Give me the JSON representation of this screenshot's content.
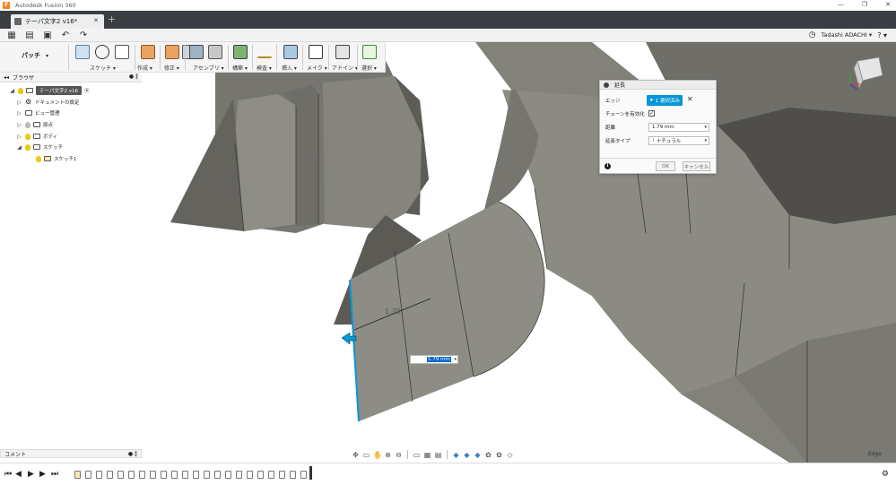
{
  "titlebar": {
    "title": "Autodesk Fusion 360",
    "controls": [
      "—",
      "❐",
      "✕"
    ]
  },
  "tab": {
    "label": "テーパ文字2 v16*",
    "close": "✕",
    "new_tab": "+"
  },
  "qab": {
    "user_name": "Tadashi ADACHI ▾",
    "help": "? ▾"
  },
  "toolbar": {
    "workspace": "パッチ",
    "groups": [
      {
        "label": "スケッチ ▾"
      },
      {
        "label": "作成 ▾"
      },
      {
        "label": "修正 ▾"
      },
      {
        "label": "アセンブリ ▾"
      },
      {
        "label": "構築 ▾"
      },
      {
        "label": "検査 ▾"
      },
      {
        "label": "挿入 ▾"
      },
      {
        "label": "メイク ▾"
      },
      {
        "label": "アドイン ▾"
      },
      {
        "label": "選択 ▾"
      }
    ]
  },
  "browser": {
    "title": "ブラウザ",
    "items": [
      {
        "label": "テーパ文字2 v16"
      },
      {
        "label": "ドキュメントの設定"
      },
      {
        "label": "ビュー管理"
      },
      {
        "label": "原点"
      },
      {
        "label": "ボディ"
      },
      {
        "label": "スケッチ"
      },
      {
        "label": "スケッチ1"
      }
    ]
  },
  "comments": {
    "title": "コメント"
  },
  "dialog": {
    "title": "延長",
    "edge_label": "エッジ",
    "edge_selection": "1 選択済み",
    "chain_label": "チェーンを有効化",
    "chain_checked": "✓",
    "distance_label": "距離",
    "distance_value": "1.79 mm",
    "type_label": "延長タイプ",
    "type_value": "ナチュラル",
    "ok": "OK",
    "cancel": "キャンセル"
  },
  "canvas": {
    "dimension_label": "1.79",
    "dimension_input": "1.79 mm"
  },
  "corner": {
    "label": "Edge"
  },
  "colors": {
    "surface_light": "#8e8d85",
    "surface_mid": "#7c7b74",
    "surface_dark": "#55544f",
    "selection_blue": "#0696d7",
    "titlebar_dark": "#3a3d41"
  }
}
